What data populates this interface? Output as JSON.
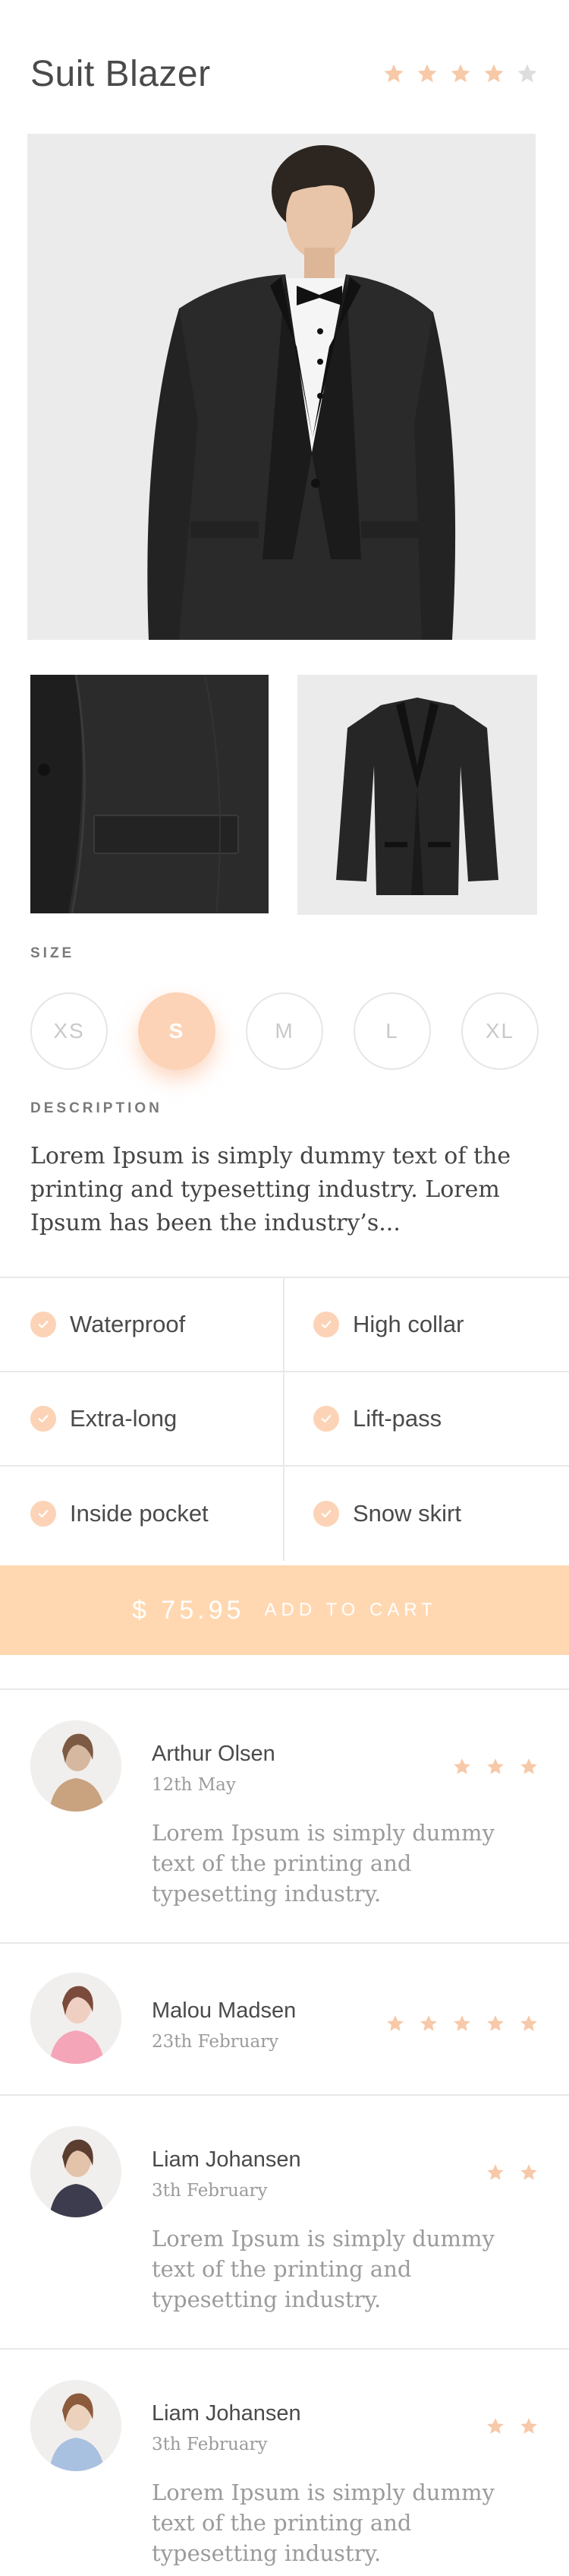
{
  "product": {
    "title": "Suit Blazer",
    "rating": 4,
    "rating_max": 5
  },
  "colors": {
    "accent": "#fcd3b6",
    "star_filled": "#f7c9a8",
    "star_empty": "#dddddd",
    "cart_bg": "#ffd8b1"
  },
  "size": {
    "label": "SIZE",
    "options": [
      "XS",
      "S",
      "M",
      "L",
      "XL"
    ],
    "selected": "S"
  },
  "description": {
    "label": "DESCRIPTION",
    "text": "Lorem Ipsum is simply dummy text of the printing and typesetting industry. Lorem Ipsum has been the industry’s..."
  },
  "features": [
    "Waterproof",
    "High collar",
    "Extra-long",
    "Lift-pass",
    "Inside pocket",
    "Snow skirt"
  ],
  "cart": {
    "price": "$ 75.95",
    "label": "ADD TO CART"
  },
  "reviews": [
    {
      "name": "Arthur Olsen",
      "date": "12th May",
      "rating": 3,
      "text": "Lorem Ipsum is simply dummy text of the printing and typesetting industry."
    },
    {
      "name": "Malou Madsen",
      "date": "23th February",
      "rating": 5,
      "text": ""
    },
    {
      "name": "Liam Johansen",
      "date": "3th February",
      "rating": 2,
      "text": "Lorem Ipsum is simply dummy text of the printing and typesetting industry."
    },
    {
      "name": "Liam Johansen",
      "date": "3th February",
      "rating": 2,
      "text": "Lorem Ipsum is simply dummy text of the printing and typesetting industry."
    }
  ]
}
